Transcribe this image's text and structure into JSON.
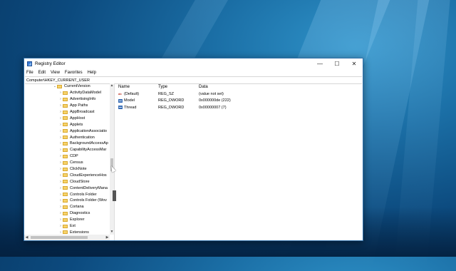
{
  "window": {
    "title": "Registry Editor",
    "controls": {
      "minimize": "—",
      "maximize": "☐",
      "close": "✕"
    }
  },
  "menu": [
    "File",
    "Edit",
    "View",
    "Favorites",
    "Help"
  ],
  "address": "Computer\\HKEY_CURRENT_USER",
  "tree": {
    "parent": "CurrentVersion",
    "items": [
      "ActivityDataModel",
      "AdvertisingInfo",
      "App Paths",
      "AppBroadcast",
      "AppHost",
      "Applets",
      "ApplicationAssociatio",
      "Authentication",
      "BackgroundAccessAp",
      "CapabilityAccessMar",
      "CDP",
      "Census",
      "ClickNote",
      "CloudExperienceHos",
      "CloudStore",
      "ContentDeliveryMana",
      "Controls Folder",
      "Controls Folder (Wov",
      "Cortana",
      "Diagnostics",
      "Explorer",
      "Ext",
      "Extensions"
    ]
  },
  "list": {
    "headers": {
      "name": "Name",
      "type": "Type",
      "data": "Data"
    },
    "rows": [
      {
        "icon": "string-value-icon",
        "name": "(Default)",
        "type": "REG_SZ",
        "data": "(value not set)"
      },
      {
        "icon": "binary-value-icon",
        "name": "Model",
        "type": "REG_DWORD",
        "data": "0x000000de (222)"
      },
      {
        "icon": "binary-value-icon",
        "name": "Thread",
        "type": "REG_DWORD",
        "data": "0x00000007 (7)"
      }
    ]
  },
  "colors": {
    "folder": "#f6d36b",
    "accent": "#2f6fa8"
  }
}
